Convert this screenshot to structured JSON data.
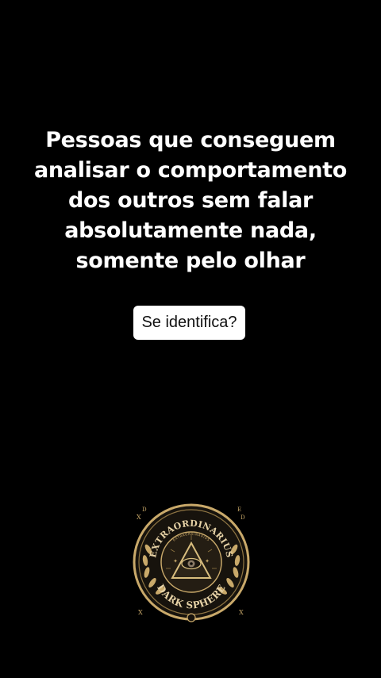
{
  "post": {
    "headline_lines": [
      "Pessoas que conseguem",
      "analisar o comportamento",
      "dos outros sem falar",
      "absolutamente nada,",
      "somente pelo olhar"
    ],
    "question": "Se identifica?"
  },
  "logo": {
    "top_text": "EXTRAORDINARIUS",
    "inner_text": "EXTRAORDINARIUS",
    "bottom_text": "DARK SPHERE",
    "corner_letters": [
      "D",
      "X",
      "E",
      "D",
      "X",
      "X"
    ],
    "icon": "all-seeing-eye-icon",
    "colors": {
      "gold": "#c9a96a",
      "dark": "#17130d",
      "eye": "#8a7a66"
    }
  }
}
